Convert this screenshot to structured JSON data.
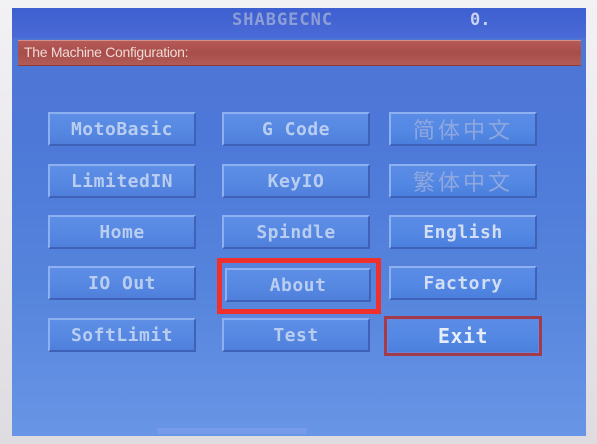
{
  "header": {
    "brand": "SHABGECNC",
    "status_value": "0."
  },
  "dialog": {
    "title": "The Machine Configuration:"
  },
  "buttons": {
    "moto_basic": "MotoBasic",
    "g_code": "G Code",
    "simplified_chinese": "简体中文",
    "limited_in": "LimitedIN",
    "key_io": "KeyIO",
    "traditional_chinese": "繁体中文",
    "home": "Home",
    "spindle": "Spindle",
    "english": "English",
    "io_out": "IO Out",
    "about": "About",
    "factory": "Factory",
    "soft_limit": "SoftLimit",
    "test": "Test",
    "exit": "Exit"
  },
  "annotation": {
    "highlight_color": "#f0302c",
    "highlighted_item": "About"
  },
  "colors": {
    "screen_blue": "#4f74d6",
    "title_red": "#b05551",
    "button_blue": "#5688e2"
  }
}
